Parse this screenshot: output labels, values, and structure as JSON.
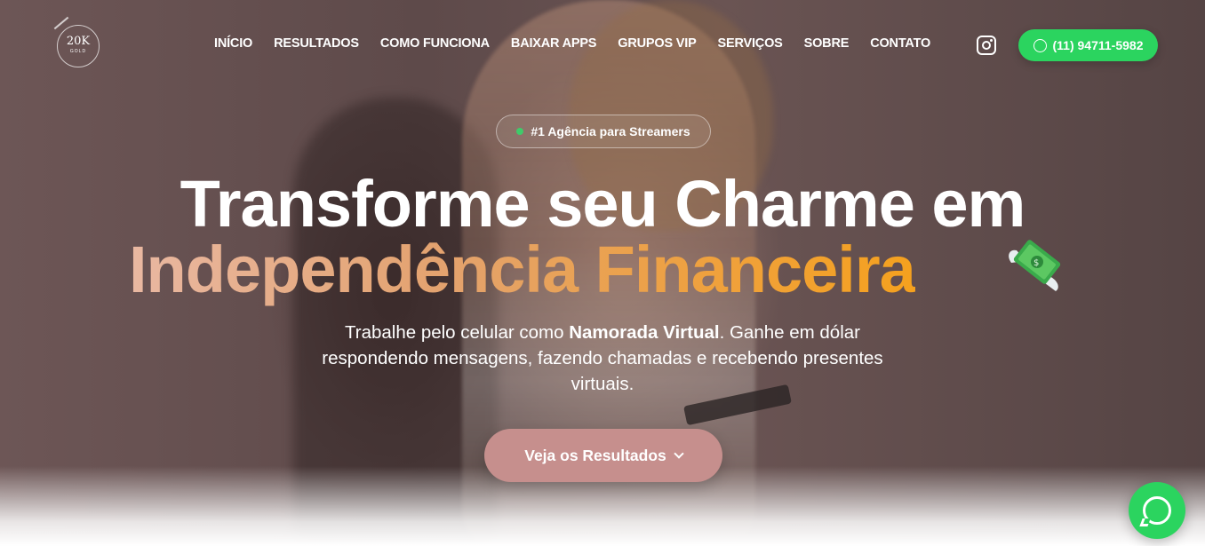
{
  "logo": {
    "main": "20K",
    "sub": "GOLD"
  },
  "nav": {
    "items": [
      {
        "label": "INÍCIO"
      },
      {
        "label": "RESULTADOS"
      },
      {
        "label": "COMO FUNCIONA"
      },
      {
        "label": "BAIXAR APPS"
      },
      {
        "label": "GRUPOS VIP"
      },
      {
        "label": "SERVIÇOS"
      },
      {
        "label": "SOBRE"
      },
      {
        "label": "CONTATO"
      }
    ]
  },
  "header": {
    "phone_label": "(11) 94711-5982",
    "instagram_icon": "instagram-icon",
    "phone_icon": "whatsapp-icon"
  },
  "hero": {
    "badge": "#1 Agência para Streamers",
    "headline_line1": "Transforme seu Charme em",
    "headline_line2": "Independência Financeira",
    "subtitle_part1": "Trabalhe pelo celular como ",
    "subtitle_bold": "Namorada Virtual",
    "subtitle_part2": ". Ganhe em dólar respondendo mensagens, fazendo chamadas e recebendo presentes virtuais.",
    "cta_label": "Veja os Resultados",
    "headline_emoji_icon": "flying-money-icon"
  },
  "colors": {
    "accent_green": "#2bd45f",
    "cta_pink": "#c68f8d",
    "gradient_start": "#e9b8a2",
    "gradient_end": "#f5a11e"
  }
}
